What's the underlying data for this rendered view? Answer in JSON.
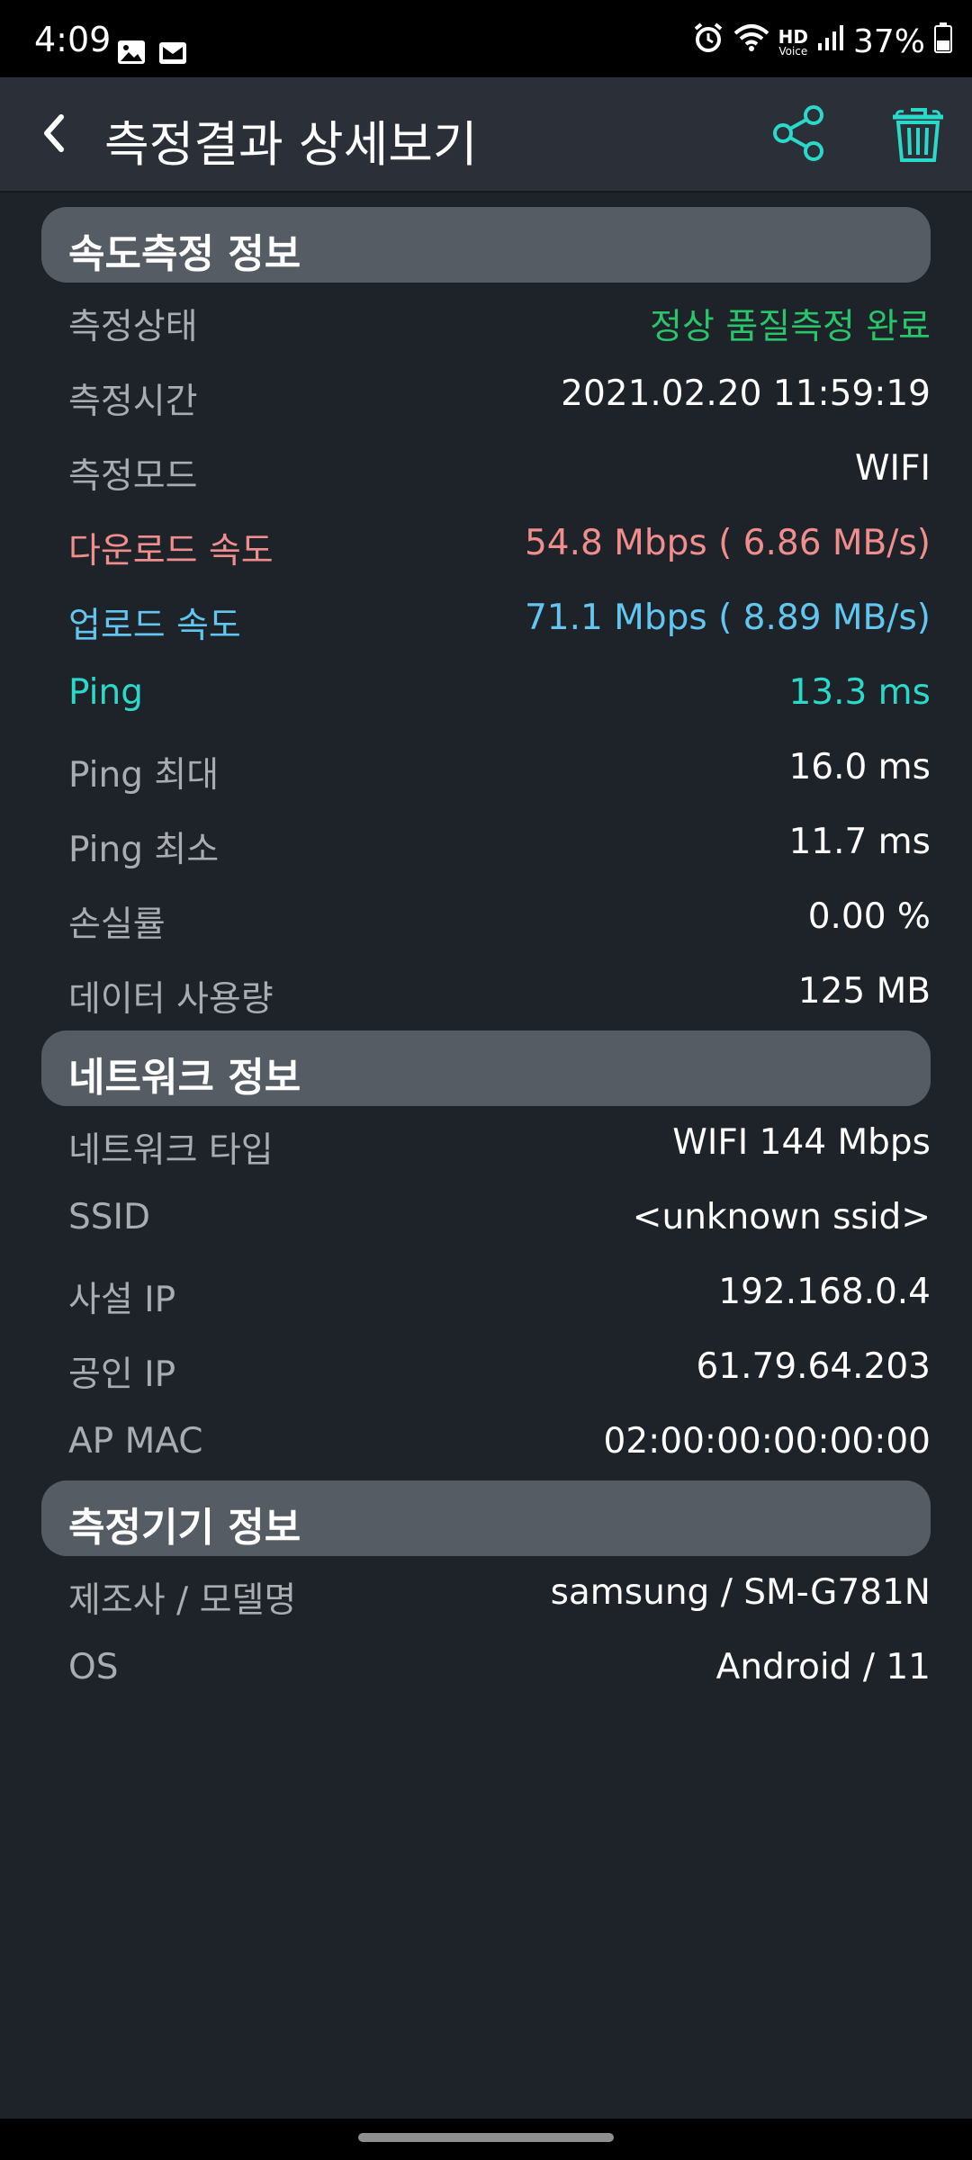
{
  "status_bar": {
    "time": "4:09",
    "battery": "37%",
    "network_badge": "HD",
    "network_badge_sub": "Voice",
    "icons": [
      "gallery-icon",
      "mail-icon",
      "alarm-icon",
      "wifi-icon",
      "signal-icon",
      "battery-icon"
    ]
  },
  "appbar": {
    "title": "측정결과 상세보기",
    "actions": [
      "share-icon",
      "trash-icon"
    ],
    "accent_color": "#2ad9c9"
  },
  "sections": {
    "speed": {
      "title": "속도측정 정보",
      "rows": [
        {
          "label": "측정상태",
          "value": "정상 품질측정 완료"
        },
        {
          "label": "측정시간",
          "value": "2021.02.20 11:59:19"
        },
        {
          "label": "측정모드",
          "value": "WIFI"
        },
        {
          "label": "다운로드 속도",
          "value": "54.8 Mbps ( 6.86 MB/s)"
        },
        {
          "label": "업로드 속도",
          "value": "71.1 Mbps ( 8.89 MB/s)"
        },
        {
          "label": "Ping",
          "value": "13.3 ms"
        },
        {
          "label": "Ping 최대",
          "value": "16.0 ms"
        },
        {
          "label": "Ping 최소",
          "value": "11.7 ms"
        },
        {
          "label": "손실률",
          "value": "0.00 %"
        },
        {
          "label": "데이터 사용량",
          "value": "125 MB"
        }
      ]
    },
    "network": {
      "title": "네트워크 정보",
      "rows": [
        {
          "label": "네트워크 타입",
          "value": "WIFI 144 Mbps"
        },
        {
          "label": "SSID",
          "value": "<unknown ssid>"
        },
        {
          "label": "사설 IP",
          "value": "192.168.0.4"
        },
        {
          "label": "공인 IP",
          "value": "61.79.64.203"
        },
        {
          "label": "AP MAC",
          "value": "02:00:00:00:00:00"
        }
      ]
    },
    "device": {
      "title": "측정기기 정보",
      "rows": [
        {
          "label": "제조사 / 모델명",
          "value": "samsung / SM-G781N"
        },
        {
          "label": "OS",
          "value": "Android / 11"
        }
      ]
    }
  },
  "colors": {
    "status_ok": "#2ac46b",
    "download": "#f08d8d",
    "upload": "#62c6f0",
    "ping": "#2ad9c9"
  }
}
